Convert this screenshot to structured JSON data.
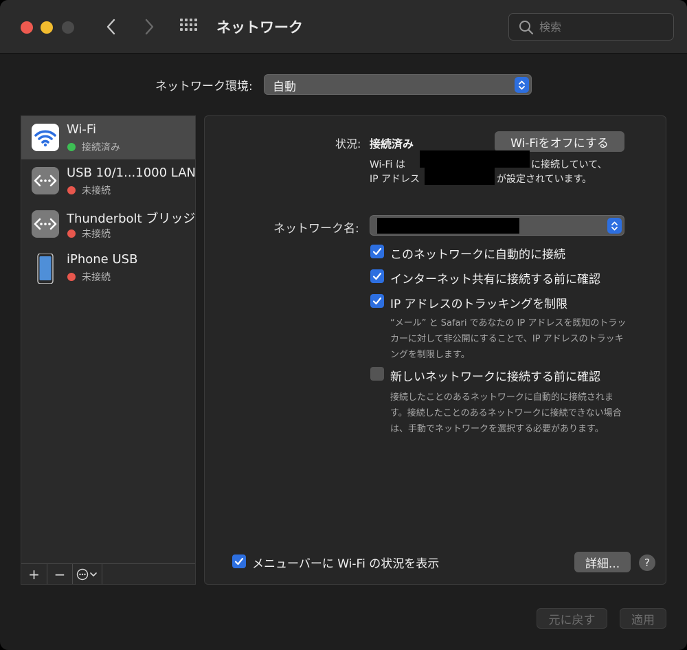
{
  "window": {
    "title": "ネットワーク"
  },
  "search": {
    "placeholder": "検索",
    "value": ""
  },
  "location": {
    "label": "ネットワーク環境:",
    "value": "自動"
  },
  "services": [
    {
      "name": "Wi-Fi",
      "status": "接続済み",
      "status_color": "#3dbf54",
      "icon": "wifi-icon",
      "selected": true
    },
    {
      "name": "USB 10/1...1000 LAN",
      "status": "未接続",
      "status_color": "#e8574d",
      "icon": "ethernet-icon",
      "selected": false
    },
    {
      "name": "Thunderbolt ブリッジ",
      "status": "未接続",
      "status_color": "#e8574d",
      "icon": "ethernet-icon",
      "selected": false
    },
    {
      "name": "iPhone USB",
      "status": "未接続",
      "status_color": "#e8574d",
      "icon": "iphone-icon",
      "selected": false
    }
  ],
  "sidebar_footer": {
    "add": "+",
    "remove": "−"
  },
  "detail": {
    "status_label": "状況:",
    "status_value": "接続済み",
    "toggle_wifi_button": "Wi-Fiをオフにする",
    "info_line1_prefix": "Wi-Fi は",
    "info_line1_suffix": "に接続していて、",
    "info_line2_prefix": "IP アドレス",
    "info_line2_suffix": "が設定されています。",
    "network_name_label": "ネットワーク名:",
    "checkboxes": [
      {
        "label": "このネットワークに自動的に接続",
        "checked": true
      },
      {
        "label": "インターネット共有に接続する前に確認",
        "checked": true
      },
      {
        "label": "IP アドレスのトラッキングを制限",
        "checked": true
      },
      {
        "label": "新しいネットワークに接続する前に確認",
        "checked": false
      }
    ],
    "desc_tracking": [
      "“メール” と Safari であなたの IP アドレスを既知のトラッ",
      "カーに対して非公開にすることで、IP アドレスのトラッキ",
      "ングを制限します。"
    ],
    "desc_ask": [
      "接続したことのあるネットワークに自動的に接続されま",
      "す。接続したことのあるネットワークに接続できない場合",
      "は、手動でネットワークを選択する必要があります。"
    ],
    "menubar_checkbox": {
      "label": "メニューバーに Wi-Fi の状況を表示",
      "checked": true
    },
    "advanced_button": "詳細...",
    "help": "?"
  },
  "footer": {
    "revert": "元に戻す",
    "apply": "適用"
  },
  "colors": {
    "accent": "#2d6fe0",
    "connected": "#3dbf54",
    "disconnected": "#e8574d"
  }
}
